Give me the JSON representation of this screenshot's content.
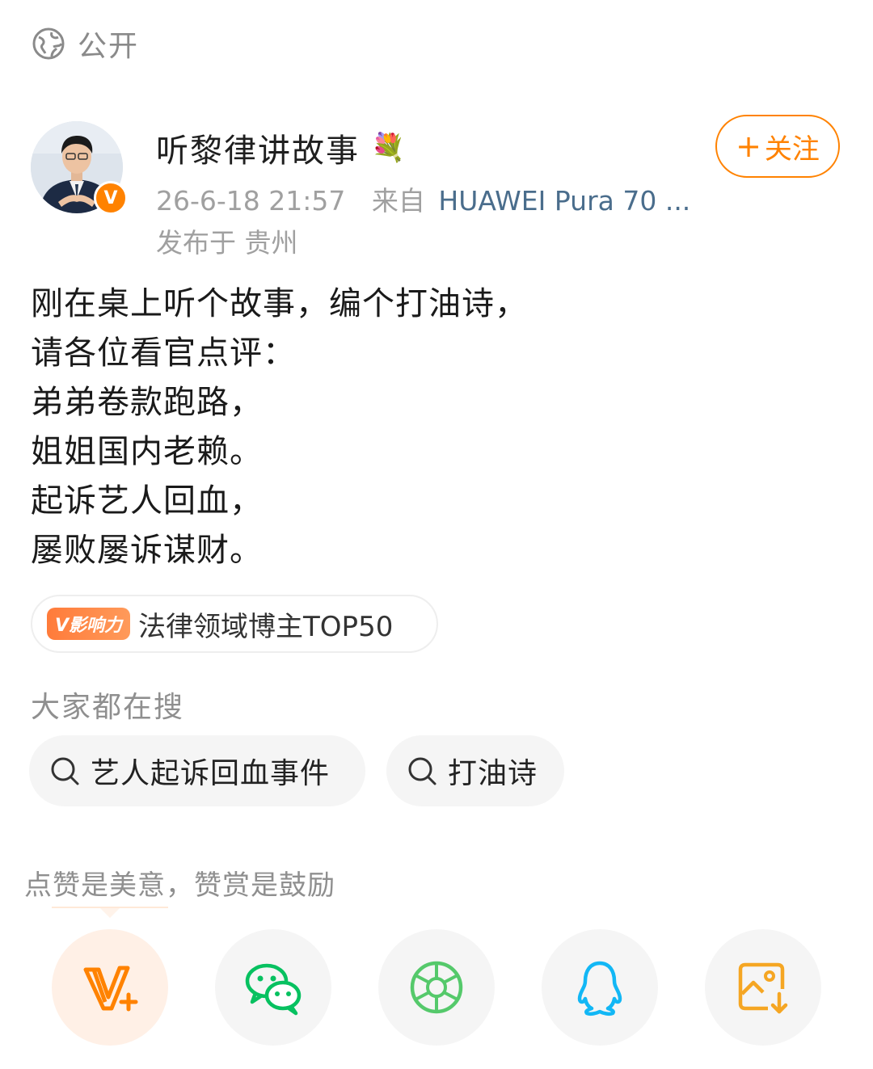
{
  "visibility": {
    "label": "公开",
    "icon": "globe-icon"
  },
  "author": {
    "name": "听黎律讲故事",
    "name_emoji": "💐",
    "verified_badge": "V",
    "time": "26-6-18 21:57",
    "source_prefix": "来自",
    "device": "HUAWEI Pura 70 ...",
    "location": "发布于 贵州"
  },
  "follow_button": {
    "plus": "+",
    "label": "关注"
  },
  "post": {
    "lines": [
      "刚在桌上听个故事，编个打油诗，",
      "请各位看官点评：",
      "弟弟卷款跑路，",
      "姐姐国内老赖。",
      "起诉艺人回血，",
      "屡败屡诉谋财。"
    ]
  },
  "influence": {
    "tag": "V影响力",
    "text": "法律领域博主TOP50"
  },
  "search": {
    "title": "大家都在搜",
    "chips": [
      "艺人起诉回血事件",
      "打油诗"
    ]
  },
  "reward": {
    "title": "点赞是美意，赞赏是鼓励"
  },
  "colors": {
    "accent": "#ff8200",
    "wechat": "#07c160",
    "moments": "#55c96b",
    "qq": "#12b7f5",
    "save": "#f5a623"
  }
}
